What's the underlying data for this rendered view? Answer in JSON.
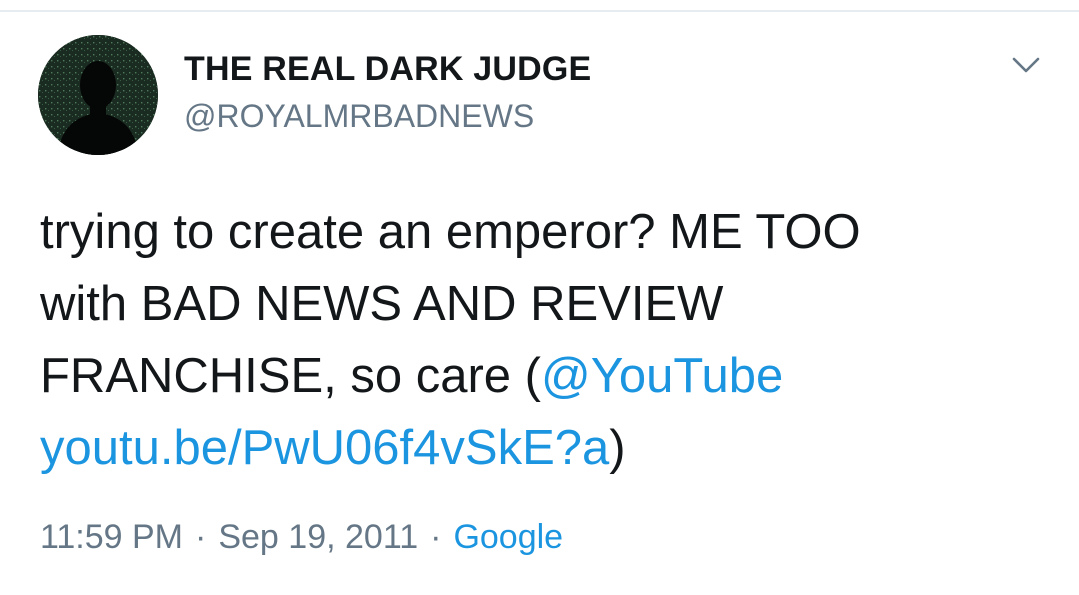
{
  "user": {
    "display_name": "THE REAL DARK JUDGE",
    "handle": "@ROYALMRBADNEWS",
    "avatar_icon": "silhouette-avatar"
  },
  "menu": {
    "icon": "chevron-down-icon"
  },
  "tweet": {
    "line1": "trying to create an emperor? ME TOO",
    "line2": "with BAD NEWS AND REVIEW",
    "line3_text": "FRANCHISE, so care (",
    "mention": "@YouTube",
    "url": "youtu.be/PwU06f4vSkE?a",
    "closing": ")"
  },
  "meta": {
    "time": "11:59 PM",
    "separator": "·",
    "date": "Sep 19, 2011",
    "source": "Google"
  },
  "colors": {
    "link": "#1b95e0",
    "secondary": "#657786",
    "text": "#14171a"
  }
}
